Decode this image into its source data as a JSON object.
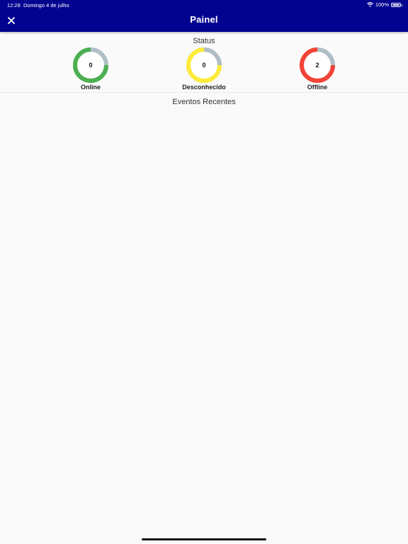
{
  "status_bar": {
    "time": "12:28",
    "date": "Domingo 4 de julho",
    "battery": "100%"
  },
  "header": {
    "title": "Painel",
    "close_icon": "close-icon"
  },
  "status_section": {
    "title": "Status",
    "gauges": [
      {
        "label": "Online",
        "value": "0",
        "color": "#4caf50",
        "fraction": 0.75
      },
      {
        "label": "Desconhecido",
        "value": "0",
        "color": "#ffeb3b",
        "fraction": 0.75
      },
      {
        "label": "Offline",
        "value": "2",
        "color": "#f44336",
        "fraction": 0.75
      }
    ],
    "track_color": "#b0bec5"
  },
  "events_section": {
    "title": "Eventos Recentes"
  }
}
